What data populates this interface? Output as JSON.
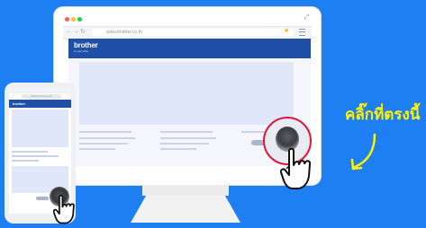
{
  "browser": {
    "url": "www.brother.co.th"
  },
  "site": {
    "logo_text": "brother",
    "tagline": "at your side"
  },
  "callout": {
    "text": "คลิ๊กที่ตรงนี้"
  },
  "icons": {
    "back": "back-arrow-icon",
    "forward": "forward-arrow-icon",
    "reload": "reload-icon",
    "star": "star-icon",
    "menu": "menu-icon",
    "expand": "expand-icon",
    "hand": "hand-pointer-icon",
    "arrow": "curved-arrow-icon"
  },
  "colors": {
    "background": "#1d7ff2",
    "brand": "#1f4fa6",
    "highlight_ring": "#e2143a",
    "callout_text": "#fff200"
  }
}
